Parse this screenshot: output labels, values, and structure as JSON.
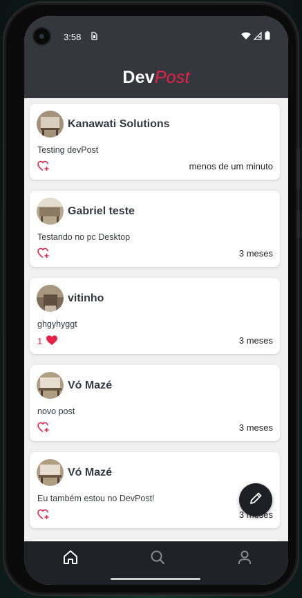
{
  "status_bar": {
    "time": "3:58"
  },
  "header": {
    "brand_part1": "Dev",
    "brand_part2": "Post"
  },
  "posts": [
    {
      "author": "Kanawati Solutions",
      "content": "Testing devPost",
      "likes": "",
      "liked": false,
      "time": "menos de um minuto"
    },
    {
      "author": "Gabriel teste",
      "content": "Testando no pc Desktop",
      "likes": "",
      "liked": false,
      "time": "3 meses"
    },
    {
      "author": "vitinho",
      "content": "ghgyhyggt",
      "likes": "1",
      "liked": true,
      "time": "3 meses"
    },
    {
      "author": "Vó Mazé",
      "content": "novo post",
      "likes": "",
      "liked": false,
      "time": "3 meses"
    },
    {
      "author": "Vó Mazé",
      "content": "Eu também estou no DevPost!",
      "likes": "",
      "liked": false,
      "time": "3 meses"
    }
  ],
  "tabs": [
    {
      "name": "home",
      "icon": "home-icon",
      "active": true
    },
    {
      "name": "search",
      "icon": "search-icon",
      "active": false
    },
    {
      "name": "profile",
      "icon": "user-icon",
      "active": false
    }
  ],
  "colors": {
    "brand_accent": "#e52246",
    "header_bg": "#35373f",
    "tabbar_bg": "#1f2126",
    "feed_bg": "#f0f0f0"
  }
}
